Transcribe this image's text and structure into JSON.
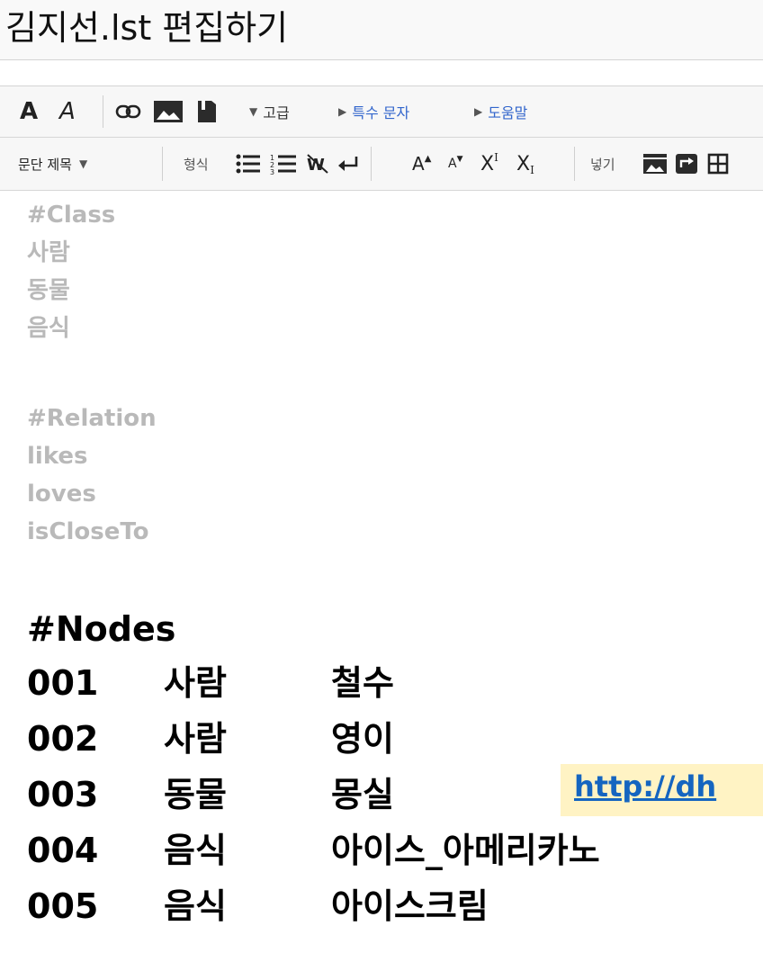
{
  "title": "김지선.lst 편집하기",
  "toolbar_top": {
    "bold_label": "A",
    "italic_label": "A",
    "advanced_label": "고급",
    "special_chars_label": "특수 문자",
    "help_label": "도움말"
  },
  "toolbar_bottom": {
    "paragraph_select": "문단 제목",
    "format_label": "형식",
    "insert_label": "넣기",
    "big_label": "A",
    "small_label": "A",
    "sup_label": "X",
    "sup_mark": "I",
    "sub_label": "X",
    "sub_mark": "I"
  },
  "editor": {
    "class_section": [
      "#Class",
      "사람",
      "동물",
      "음식"
    ],
    "relation_section": [
      "#Relation",
      "likes",
      "loves",
      "isCloseTo"
    ],
    "nodes_header": "#Nodes",
    "nodes": [
      {
        "id": "001",
        "class": "사람",
        "name": "철수"
      },
      {
        "id": "002",
        "class": "사람",
        "name": "영이"
      },
      {
        "id": "003",
        "class": "동물",
        "name": "몽실"
      },
      {
        "id": "004",
        "class": "음식",
        "name": "아이스_아메리카노"
      },
      {
        "id": "005",
        "class": "음식",
        "name": "아이스크림"
      }
    ],
    "overlay_url": "http://dh"
  },
  "colors": {
    "link_blue": "#3366cc",
    "gray_text": "#b9b9b9",
    "url_highlight": "#fff3c4",
    "url_text": "#1565c0"
  }
}
